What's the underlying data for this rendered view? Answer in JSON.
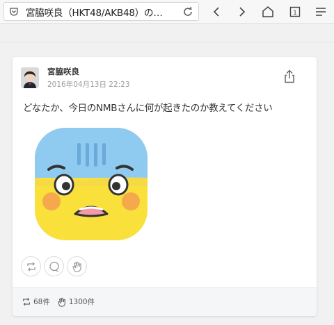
{
  "browser": {
    "tab_title": "宮脇咲良（HKT48/AKB48）の…",
    "icons": [
      "pocket-icon",
      "reload-icon",
      "back-icon",
      "forward-icon",
      "home-icon",
      "tabs-icon",
      "menu-icon"
    ],
    "tab_count": "1"
  },
  "post": {
    "username": "宮脇咲良",
    "timestamp": "2016年04月13日 22:23",
    "text": "どなたか、今日のNMBさんに何が起きたのか教えてください",
    "emoji": "worried-face-sticker"
  },
  "actions": {
    "icons": [
      "repost-icon",
      "comment-icon",
      "clap-icon"
    ]
  },
  "stats": {
    "reposts": "68件",
    "claps": "1300件"
  }
}
